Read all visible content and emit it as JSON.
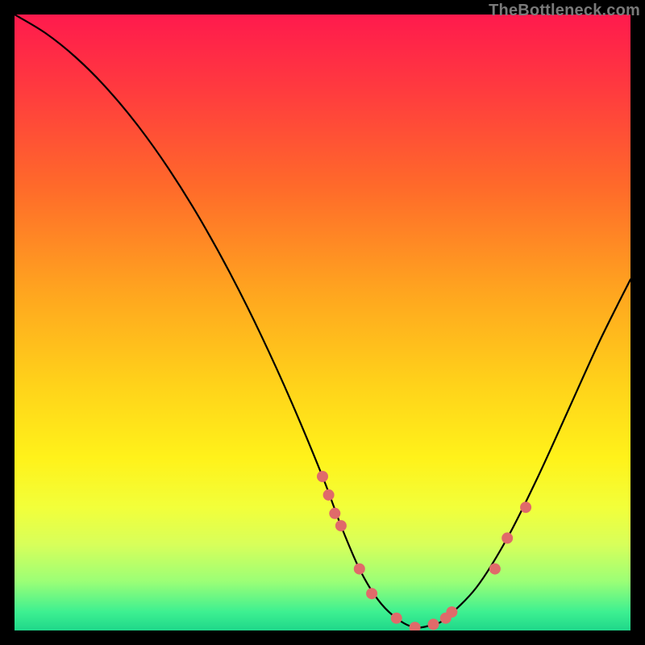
{
  "watermark": "TheBottleneck.com",
  "chart_data": {
    "type": "line",
    "title": "",
    "xlabel": "",
    "ylabel": "",
    "xlim": [
      0,
      100
    ],
    "ylim": [
      0,
      100
    ],
    "series": [
      {
        "name": "curve",
        "x": [
          0,
          5,
          10,
          15,
          20,
          25,
          30,
          35,
          40,
          45,
          50,
          53,
          56,
          59,
          62,
          65,
          68,
          70,
          75,
          80,
          85,
          90,
          95,
          100
        ],
        "y": [
          100,
          97,
          93,
          88,
          82,
          75,
          67,
          58,
          48,
          37,
          25,
          17,
          10,
          5,
          2,
          0.5,
          1,
          2,
          7,
          15,
          25,
          36,
          47,
          57
        ]
      }
    ],
    "points": {
      "name": "markers",
      "color": "#e06a6a",
      "x": [
        50,
        51,
        52,
        53,
        56,
        58,
        62,
        65,
        68,
        70,
        71,
        78,
        80,
        83
      ],
      "y": [
        25,
        22,
        19,
        17,
        10,
        6,
        2,
        0.5,
        1,
        2,
        3,
        10,
        15,
        20
      ]
    }
  }
}
